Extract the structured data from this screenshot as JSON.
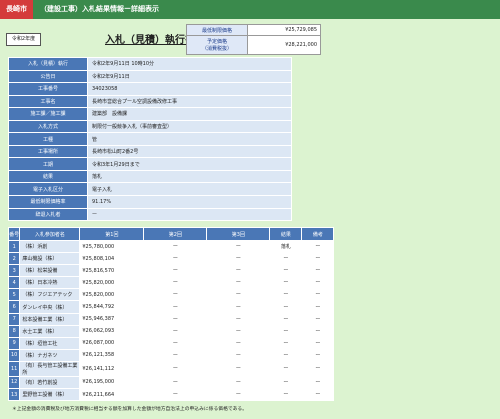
{
  "header": {
    "city": "長崎市",
    "title": "（建設工事）入札結果情報ー詳細表示"
  },
  "era_label": "令和2年度",
  "doc_title": "入札（見積）執行書",
  "prices": [
    {
      "label": "最低制限価格",
      "value": "¥25,729,085"
    },
    {
      "label": "予定価格\n（消費税抜）",
      "value": "¥28,221,000"
    }
  ],
  "info": [
    {
      "label": "入札（見積）執行",
      "value": "令和2年9月11日 10時10分"
    },
    {
      "label": "公告日",
      "value": "令和2年9月11日"
    },
    {
      "label": "工事番号",
      "value": "34023058"
    },
    {
      "label": "工事名",
      "value": "長崎市営総合プール空調設備改修工事"
    },
    {
      "label": "施工課／施工課",
      "value": "建築部　設備課"
    },
    {
      "label": "入札方式",
      "value": "制限付一般競争入札（事前審査型）"
    },
    {
      "label": "工種",
      "value": "管"
    },
    {
      "label": "工事場所",
      "value": "長崎市松山町2番2号"
    },
    {
      "label": "工期",
      "value": "令和3年1月29日まで"
    },
    {
      "label": "結果",
      "value": "落札"
    },
    {
      "label": "電子入札区分",
      "value": "電子入札"
    },
    {
      "label": "最低制限価格率",
      "value": "91.17%"
    },
    {
      "label": "辞退入札者",
      "value": "ー"
    }
  ],
  "bids": {
    "headers": [
      "番号",
      "入札参加者名",
      "第1回",
      "第2回",
      "第3回",
      "結果",
      "備考"
    ],
    "rows": [
      {
        "no": "1",
        "name": "（株）浜創",
        "r1": "¥25,780,000",
        "r2": "ー",
        "r3": "ー",
        "result": "落札",
        "note": "ー"
      },
      {
        "no": "2",
        "name": "庫山機設（株）",
        "r1": "¥25,808,104",
        "r2": "ー",
        "r3": "ー",
        "result": "ー",
        "note": "ー"
      },
      {
        "no": "3",
        "name": "（株）松栄設備",
        "r1": "¥25,816,570",
        "r2": "ー",
        "r3": "ー",
        "result": "ー",
        "note": "ー"
      },
      {
        "no": "4",
        "name": "（株）日本冷熱",
        "r1": "¥25,820,000",
        "r2": "ー",
        "r3": "ー",
        "result": "ー",
        "note": "ー"
      },
      {
        "no": "5",
        "name": "（株）フジエアテック",
        "r1": "¥25,820,000",
        "r2": "ー",
        "r3": "ー",
        "result": "ー",
        "note": "ー"
      },
      {
        "no": "6",
        "name": "ダンレイ中央（株）",
        "r1": "¥25,844,792",
        "r2": "ー",
        "r3": "ー",
        "result": "ー",
        "note": "ー"
      },
      {
        "no": "7",
        "name": "松本設備工業（株）",
        "r1": "¥25,946,387",
        "r2": "ー",
        "r3": "ー",
        "result": "ー",
        "note": "ー"
      },
      {
        "no": "8",
        "name": "水士工業（株）",
        "r1": "¥26,062,093",
        "r2": "ー",
        "r3": "ー",
        "result": "ー",
        "note": "ー"
      },
      {
        "no": "9",
        "name": "（株）垣管工社",
        "r1": "¥26,087,000",
        "r2": "ー",
        "r3": "ー",
        "result": "ー",
        "note": "ー"
      },
      {
        "no": "10",
        "name": "（株）ナガネツ",
        "r1": "¥26,121,358",
        "r2": "ー",
        "r3": "ー",
        "result": "ー",
        "note": "ー"
      },
      {
        "no": "11",
        "name": "（有）長与管工設備工業所",
        "r1": "¥26,141,112",
        "r2": "ー",
        "r3": "ー",
        "result": "ー",
        "note": "ー"
      },
      {
        "no": "12",
        "name": "（有）若竹創設",
        "r1": "¥26,195,000",
        "r2": "ー",
        "r3": "ー",
        "result": "ー",
        "note": "ー"
      },
      {
        "no": "13",
        "name": "里野管工設備（株）",
        "r1": "¥26,211,664",
        "r2": "ー",
        "r3": "ー",
        "result": "ー",
        "note": "ー"
      }
    ]
  },
  "footnote": "＊上記金額の消費税及び地方消費税に相当する額を加算した金額が地方自治法上の申込みに係る価格である。"
}
